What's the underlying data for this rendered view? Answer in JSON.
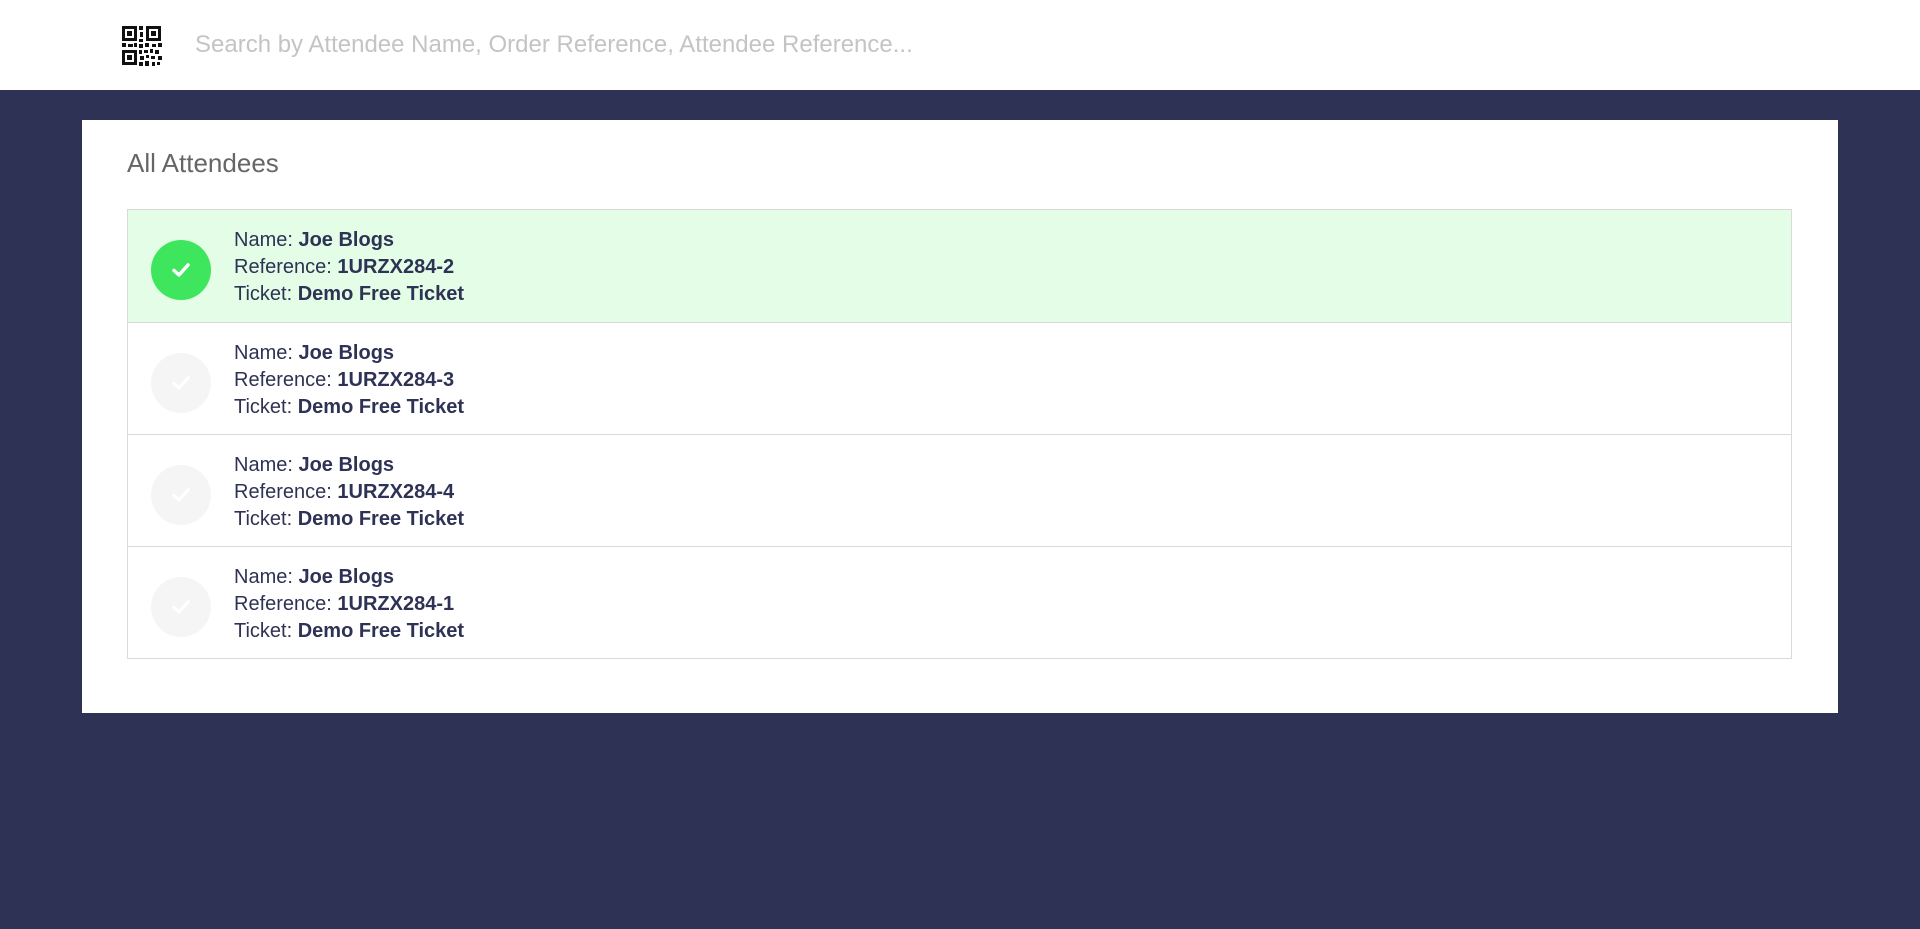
{
  "search": {
    "placeholder": "Search by Attendee Name, Order Reference, Attendee Reference...",
    "icon": "qr-code-icon"
  },
  "colors": {
    "page_background": "#2e3254",
    "checked_row": "#e3fde6",
    "checked_circle": "#3ee65d",
    "unchecked_circle": "#f5f5f5"
  },
  "attendees_panel": {
    "title": "All Attendees",
    "name_label": "Name:",
    "reference_label": "Reference:",
    "ticket_label": "Ticket:",
    "rows": [
      {
        "checked": true,
        "name": "Joe Blogs",
        "reference": "1URZX284-2",
        "ticket": "Demo Free Ticket"
      },
      {
        "checked": false,
        "name": "Joe Blogs",
        "reference": "1URZX284-3",
        "ticket": "Demo Free Ticket"
      },
      {
        "checked": false,
        "name": "Joe Blogs",
        "reference": "1URZX284-4",
        "ticket": "Demo Free Ticket"
      },
      {
        "checked": false,
        "name": "Joe Blogs",
        "reference": "1URZX284-1",
        "ticket": "Demo Free Ticket"
      }
    ]
  }
}
